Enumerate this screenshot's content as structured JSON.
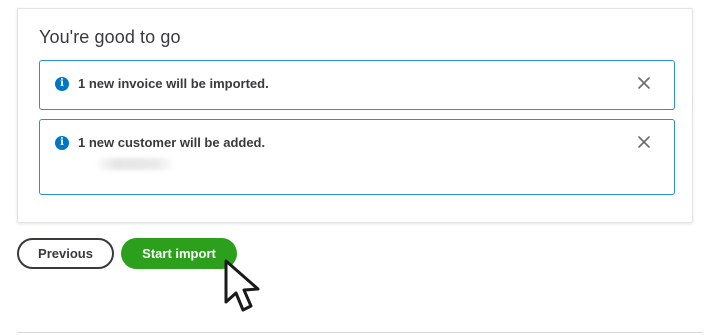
{
  "card": {
    "title": "You're good to go"
  },
  "notices": [
    {
      "icon": "info-icon",
      "text": "1 new invoice will be imported.",
      "close_icon": "close-icon"
    },
    {
      "icon": "info-icon",
      "text": "1 new customer will be added.",
      "close_icon": "close-icon"
    }
  ],
  "actions": {
    "previous_label": "Previous",
    "start_label": "Start import"
  },
  "colors": {
    "accent_green": "#2ca01c",
    "info_blue": "#0077c5",
    "notice_border": "#2d8ed8",
    "text_dark": "#393a3d"
  }
}
